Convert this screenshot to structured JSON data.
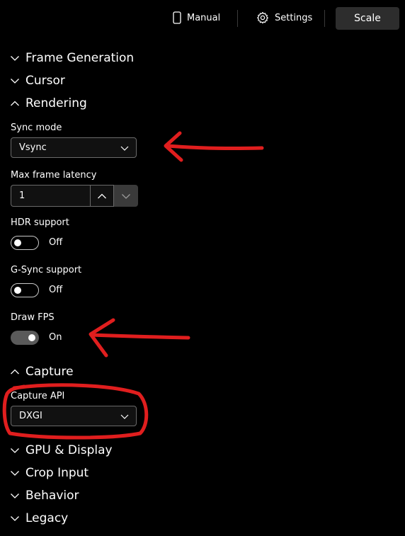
{
  "topbar": {
    "manual_label": "Manual",
    "settings_label": "Settings",
    "scale_label": "Scale"
  },
  "sections": {
    "frame_generation": "Frame Generation",
    "cursor": "Cursor",
    "rendering": "Rendering",
    "capture": "Capture",
    "gpu_display": "GPU & Display",
    "crop_input": "Crop Input",
    "behavior": "Behavior",
    "legacy": "Legacy"
  },
  "rendering": {
    "sync_mode_label": "Sync mode",
    "sync_mode_value": "Vsync",
    "max_frame_latency_label": "Max frame latency",
    "max_frame_latency_value": "1",
    "hdr_label": "HDR support",
    "hdr_state": "Off",
    "gsync_label": "G-Sync support",
    "gsync_state": "Off",
    "draw_fps_label": "Draw FPS",
    "draw_fps_state": "On"
  },
  "capture": {
    "api_label": "Capture API",
    "api_value": "DXGI"
  },
  "colors": {
    "background": "#000000",
    "annotation": "#e01e1e"
  }
}
